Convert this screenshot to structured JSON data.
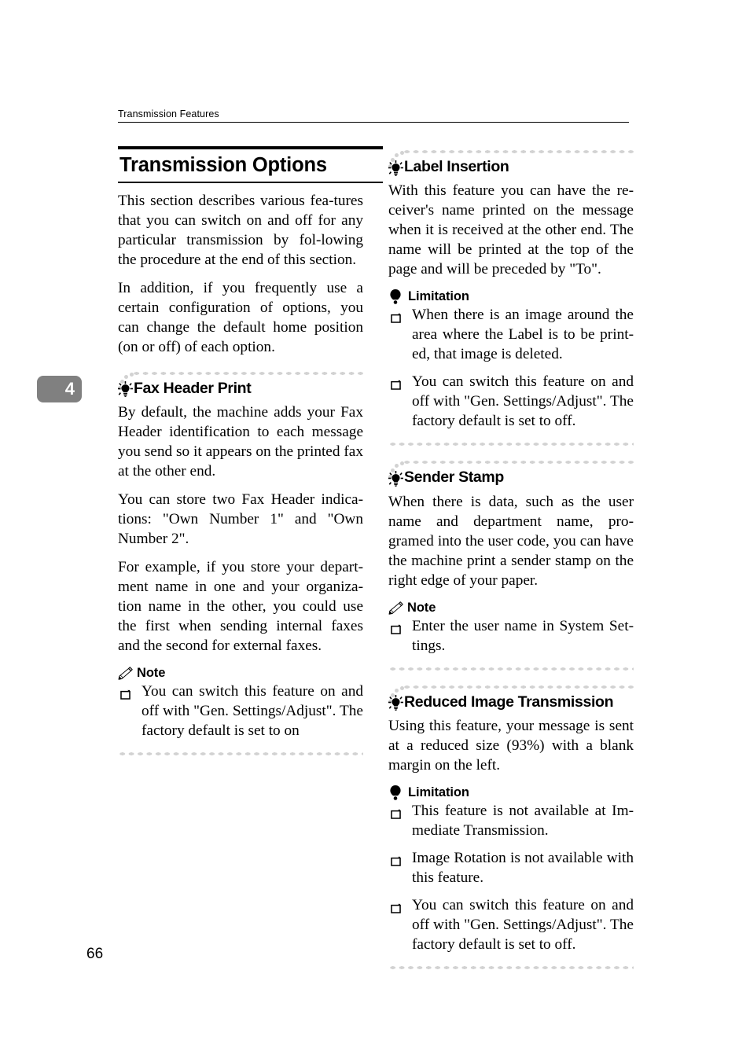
{
  "page": {
    "running_header": "Transmission Features",
    "chapter_marker": "4",
    "page_number": "66"
  },
  "icons": {
    "bulb": "lightbulb-icon",
    "pencil": "pencil-note-icon",
    "limitation": "limitation-bulb-icon",
    "bullet": "square-bullet-icon"
  },
  "colors": {
    "text": "#000000",
    "dots": "#d2d2d2",
    "chapter_tab_bg": "#808080",
    "chapter_tab_text": "#ffffff"
  },
  "left_column": {
    "section": {
      "title": "Transmission Options",
      "paragraphs": [
        "This section describes various fea-tures that you can switch on and off for any particular transmission by fol-lowing the procedure at the end of this section.",
        "In addition, if you frequently use a certain configuration of options, you can change the default home position (on or off) of each option."
      ]
    },
    "features": [
      {
        "title": "Fax Header Print",
        "paragraphs": [
          "By default, the machine adds your Fax Header identification to each message you send so it appears on the printed fax at the other end.",
          "You can store two Fax Header indica-tions: \"Own Number 1\" and \"Own Number 2\".",
          "For example, if you store your depart-ment name in one and your organiza-tion name in the other, you could use the first when sending internal faxes and the second for external faxes."
        ],
        "callouts": [
          {
            "type": "note",
            "label": "Note",
            "items": [
              "You can switch this feature on and off with \"Gen. Settings/Adjust\". The factory default is set to on"
            ]
          }
        ]
      }
    ]
  },
  "right_column": {
    "features": [
      {
        "title": "Label Insertion",
        "paragraphs": [
          "With this feature you can have the re-ceiver's name printed on the message when it is received at the other end. The name will be printed at the top of the page and will be preceded by \"To\"."
        ],
        "callouts": [
          {
            "type": "limitation",
            "label": "Limitation",
            "items": [
              "When there is an image around the area where the Label is to be print-ed, that image is deleted.",
              "You can switch this feature on and off with \"Gen. Settings/Adjust\". The factory default is set to off."
            ]
          }
        ]
      },
      {
        "title": "Sender Stamp",
        "paragraphs": [
          "When there is data, such as the user name and department name, pro-gramed into the user code, you can have the machine print a sender stamp on the right edge of your paper."
        ],
        "callouts": [
          {
            "type": "note",
            "label": "Note",
            "items": [
              "Enter the user name in System Set-tings."
            ]
          }
        ]
      },
      {
        "title": "Reduced Image Transmission",
        "paragraphs": [
          "Using this feature, your message is sent at a reduced size (93%) with a blank margin on the left."
        ],
        "callouts": [
          {
            "type": "limitation",
            "label": "Limitation",
            "items": [
              "This feature is not available at Im-mediate Transmission.",
              "Image Rotation is not available with this feature.",
              "You can switch this feature on and off with \"Gen. Settings/Adjust\". The factory default is set to off."
            ]
          }
        ]
      }
    ]
  }
}
